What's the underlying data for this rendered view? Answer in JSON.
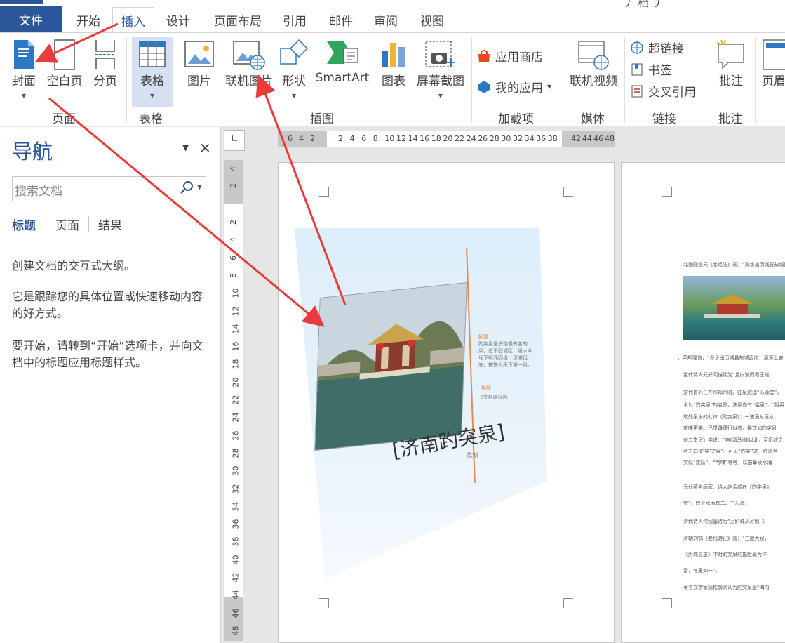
{
  "window": {
    "title_fragment": "丿 档 丿"
  },
  "tabs": [
    {
      "label": "文件"
    },
    {
      "label": "开始"
    },
    {
      "label": "插入"
    },
    {
      "label": "设计"
    },
    {
      "label": "页面布局"
    },
    {
      "label": "引用"
    },
    {
      "label": "邮件"
    },
    {
      "label": "审阅"
    },
    {
      "label": "视图"
    }
  ],
  "ribbon": {
    "groups": {
      "pages": "页面",
      "table": "表格",
      "illustrations": "插图",
      "addins": "加载项",
      "media": "媒体",
      "links": "链接",
      "comments": "批注"
    },
    "buttons": {
      "cover": "封面",
      "blank_page": "空白页",
      "page_break": "分页",
      "table": "表格",
      "picture": "图片",
      "online_picture": "联机图片",
      "shapes": "形状",
      "smartart": "SmartArt",
      "chart": "图表",
      "screenshot": "屏幕截图",
      "store": "应用商店",
      "my_apps": "我的应用",
      "online_video": "联机视频",
      "hyperlink": "超链接",
      "bookmark": "书签",
      "cross_reference": "交叉引用",
      "comment": "批注",
      "header": "页眉"
    }
  },
  "nav": {
    "title": "导航",
    "search_placeholder": "搜索文档",
    "tabs": [
      "标题",
      "页面",
      "结果"
    ],
    "p1": "创建文档的交互式大纲。",
    "p2": "它是跟踪您的具体位置或快速移动内容的好方式。",
    "p3": "要开始，请转到“开始”选项卡，并向文档中的标题应用标题样式。"
  },
  "ruler": {
    "h": [
      "6",
      "4",
      "2",
      "2",
      "4",
      "6",
      "8",
      "10",
      "12",
      "14",
      "16",
      "18",
      "20",
      "22",
      "24",
      "26",
      "28",
      "30",
      "32",
      "34",
      "36",
      "38",
      "42",
      "44",
      "46",
      "48"
    ],
    "v": [
      "4",
      "2",
      "2",
      "4",
      "6",
      "8",
      "10",
      "12",
      "14",
      "16",
      "18",
      "20",
      "22",
      "24",
      "26",
      "28",
      "30",
      "32",
      "34",
      "36",
      "38",
      "40",
      "42",
      "44",
      "46",
      "48"
    ]
  },
  "cover": {
    "title": "[济南趵突泉]",
    "author": "欧昕",
    "abstract_label": "摘要",
    "abstract_text": "趵突泉是济南最有名的泉，位于旧城区，泉水从地下喷涌而出，清澈见底，被誉为天下第一泉。",
    "subtitle_label": "标题",
    "subtitle": "[文档副标题]"
  },
  "page2": {
    "lines": [
      "北魏郦道元《水经注》载：“泺水出历城县故城西南，",
      "。芦知隆育，“泺水出历城县故城西南，泉源上奋",
      "金代诗人元好问描绘为“且向波间看玉塔",
      "宋代曾巩任齐州知州时，在泉边建“泺源堂”，",
      "水以“趵突泉”的名称。该泉亦有“槛泉”、“娥英",
      "故处泉水的七律《趵突泉》：一波涌从玉水",
      "茶味更美。已觉踌躇行似者，最饮如趵突泉",
      "州二堂记》中说：“自(渴马)崖以北，至历城之",
      "名之曰‘趵突’之泉”。可见“趵突”这一称谓当",
      "突似“跳跃”、“咆哮”等等，以描摹泉水涌",
      "元代著名画家、诗人赵孟頫在《趵突泉》",
      "雪”。趵上水面有二、三尺高。",
      "清代诗人何绍基诗为“万斛珠玑尽倒飞",
      "清朝刘鹗《老残游记》载：“三股大泉，",
      "《历城县志》中对趵突泉的描绘最为详",
      "雷，冬夏如一”。",
      "著名文学家蒲松龄则认为趵突泉是“海内"
    ]
  }
}
